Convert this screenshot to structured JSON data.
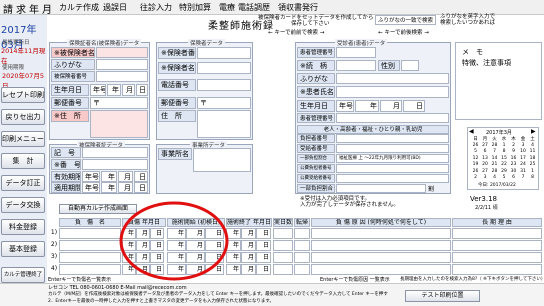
{
  "menu": {
    "items": [
      "請",
      "求",
      "年",
      "月",
      "カルテ作成",
      "過誤日",
      "往診入力",
      "特別加算",
      "電療",
      "電話調歴",
      "領収書発行"
    ]
  },
  "sidebar": {
    "year_month": "2017年03月",
    "update_label": "最終更新日",
    "update_date": "2014年11月現在",
    "service_label": "使用期限",
    "service_date": "2020年07月5日",
    "buttons": [
      "レセプト印刷",
      "戻りセ出力",
      "印刷メニュー",
      "集　計",
      "データ訂正",
      "データ交換",
      "料金登録",
      "基本登録"
    ],
    "bottom_button": "カルテ管理終了"
  },
  "header": {
    "title": "柔整師施術録",
    "note": "被保険者カードをセットデータを作成してから\n　　　　　　保存して下さい",
    "arrow_note": "← キーで前前で検索 →",
    "kana_note": "ふりがなの一致で検索",
    "kana_note2": "ふりがなを英字入力で\n検索したいつかあれば",
    "search_note": "← キーで前後検索 →"
  },
  "insured": {
    "title": "保険証者名(被保険者)データ",
    "name_label": "※被保険者名",
    "kana_label": "ふりがな",
    "number_label": "被保険者番号",
    "birth_label": "生年月日",
    "birth_era": "年号",
    "year": "年",
    "month": "月",
    "day": "日",
    "zip_label": "郵便番号",
    "zip_mark": "〒",
    "address_label": "※住　所"
  },
  "insurer": {
    "title": "保険者データ",
    "number_label": "※保険者番号",
    "name_label": "※保険者名",
    "phone_label": "電話番号",
    "zip_label": "郵便番号",
    "zip_mark": "〒",
    "address_label": "住　所"
  },
  "subsidy": {
    "title": "被保険者証データ",
    "symbol_label": "記　号",
    "number_label": "※番　号",
    "valid_label": "有効期限",
    "grant_label": "適用期間",
    "era": "年号",
    "year": "年",
    "month": "月",
    "day": "日"
  },
  "office": {
    "title": "事業所データ",
    "name_label": "事業所名"
  },
  "patient": {
    "title": "受診者(患者)データ",
    "manage_label": "患者管理番号",
    "relation_label": "※続　柄",
    "sex_label": "性別",
    "kana_label": "ふりがな",
    "name_label": "※患者氏名",
    "birth_label": "生年月日",
    "era": "年号",
    "year": "年",
    "month": "月",
    "day": "日",
    "record_label": "患者管理番号",
    "elder_title": "老人・高齢者・福祉・ひとり親・乳幼児",
    "burden_label": "負担者番号",
    "recipient_label": "受給者番号",
    "public_label": "一部負担割合",
    "welfare_label": "福祉医療 上 ～22年九月限り利用可(BD)",
    "public2_label": "公費負担者番号",
    "public3_label": "公費受給者番号",
    "copay_label": "一部負担割合",
    "copay_unit": "割"
  },
  "memo": {
    "title": "メ　モ",
    "subtitle": "特徴、注意事項"
  },
  "calendar": {
    "month_label": "2017年3月",
    "days_header": [
      "日",
      "月",
      "火",
      "水",
      "木",
      "金",
      "土"
    ],
    "rows": [
      [
        "26",
        "27",
        "28",
        "1",
        "2",
        "3",
        "4"
      ],
      [
        "5",
        "6",
        "7",
        "8",
        "9",
        "10",
        "11"
      ],
      [
        "12",
        "13",
        "14",
        "15",
        "16",
        "17",
        "18"
      ],
      [
        "19",
        "20",
        "21",
        "22",
        "23",
        "24",
        "25"
      ],
      [
        "26",
        "27",
        "28",
        "29",
        "30",
        "31",
        "1"
      ],
      [
        "2",
        "3",
        "4",
        "5",
        "6",
        "7",
        "8"
      ]
    ],
    "today_label": "今日: 2017/03/22"
  },
  "version": {
    "label": "Ver3.18",
    "date": "2/2/11 頃"
  },
  "auto_button": "自動再カルテ作成画面",
  "info_note": "※受付は入力必須項目です。\n入力が完了しデータが保存されません。",
  "grid": {
    "headers": [
      "負　傷　名",
      "負傷 年月日",
      "施術開始 (初検日)",
      "施術終了 年月日",
      "実日数",
      "転帰",
      "負 傷 原 因 (何時何処で何をして)",
      "長 期 理 由"
    ],
    "rows": [
      {
        "no": "1)",
        "y": "年",
        "m": "月",
        "d": "日"
      },
      {
        "no": "2)",
        "y": "年",
        "m": "月",
        "d": "日"
      },
      {
        "no": "3)",
        "y": "年",
        "m": "月",
        "d": "日"
      },
      {
        "no": "4)",
        "y": "年",
        "m": "月",
        "d": "日"
      }
    ]
  },
  "status": {
    "line1": "Enterキーで負傷名一覧表示",
    "line1b": "Enterキーで負傷原因 一覧表示",
    "line1c": "長期理由を入力したのを検索入力為8?（ ※下キボタンを押して下さい）",
    "line2": "レセコン TEL 080-0601-0680 E-Mail mail@rececom.com",
    "line3": "カルテ（M/M記）を作成後検索対象は被保険者データ及び患者のデータ入力をして Enter キーを押します。最後確認したいのでくだ今データ入力して Enter キーを押す",
    "line4": "2．Enterキーを最後の一時押した入力を押すと上書きマスタの変更データをも入力保存された状態になります。",
    "test_button": "テスト印刷位置"
  }
}
